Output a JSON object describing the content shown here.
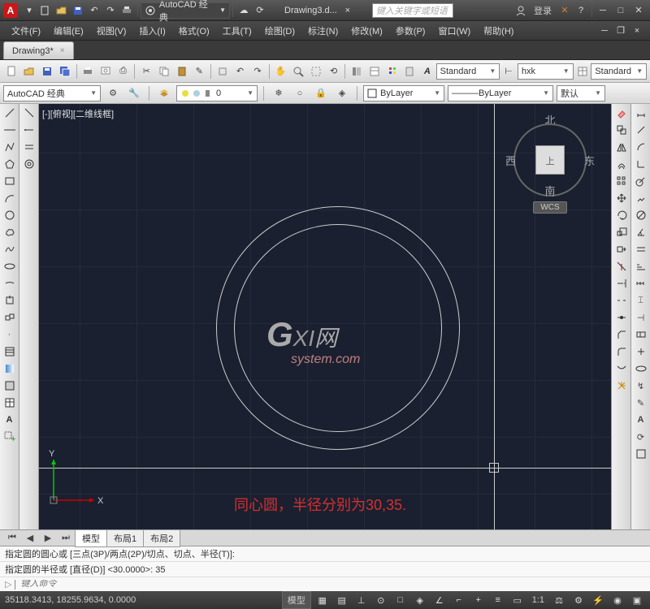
{
  "title": {
    "workspace": "AutoCAD 经典",
    "doc": "Drawing3.d...",
    "search_ph": "键入关键字或短语",
    "signin": "登录"
  },
  "menu": {
    "file": "文件(F)",
    "edit": "编辑(E)",
    "view": "视图(V)",
    "insert": "插入(I)",
    "format": "格式(O)",
    "tools": "工具(T)",
    "draw": "绘图(D)",
    "dim": "标注(N)",
    "modify": "修改(M)",
    "params": "参数(P)",
    "window": "窗口(W)",
    "help": "帮助(H)"
  },
  "tab": {
    "name": "Drawing3*"
  },
  "styles": {
    "text": "Standard",
    "dim": "hxk",
    "table": "Standard"
  },
  "props": {
    "workspace": "AutoCAD 经典",
    "layer": "ByLayer",
    "linetype": "ByLayer",
    "weight": "默认"
  },
  "viewport": {
    "label": "[-][俯视][二维线框]",
    "annotation": "同心圆，半径分别为30,35.",
    "compass": {
      "n": "北",
      "s": "南",
      "e": "东",
      "w": "西",
      "top": "上",
      "wcs": "WCS"
    }
  },
  "layout": {
    "model": "模型",
    "layout1": "布局1",
    "layout2": "布局2"
  },
  "cmd": {
    "line1": "指定圆的圆心或 [三点(3P)/两点(2P)/切点、切点、半径(T)]:",
    "line2": "指定圆的半径或 [直径(D)] <30.0000>: 35",
    "prompt_icon": "▷",
    "input_ph": "键入命令"
  },
  "status": {
    "coords": "35118.3413, 18255.9634, 0.0000",
    "model": "模型"
  },
  "watermark": {
    "g": "G",
    "xi": "XI",
    "cn": "网",
    "sys": "system.com"
  }
}
